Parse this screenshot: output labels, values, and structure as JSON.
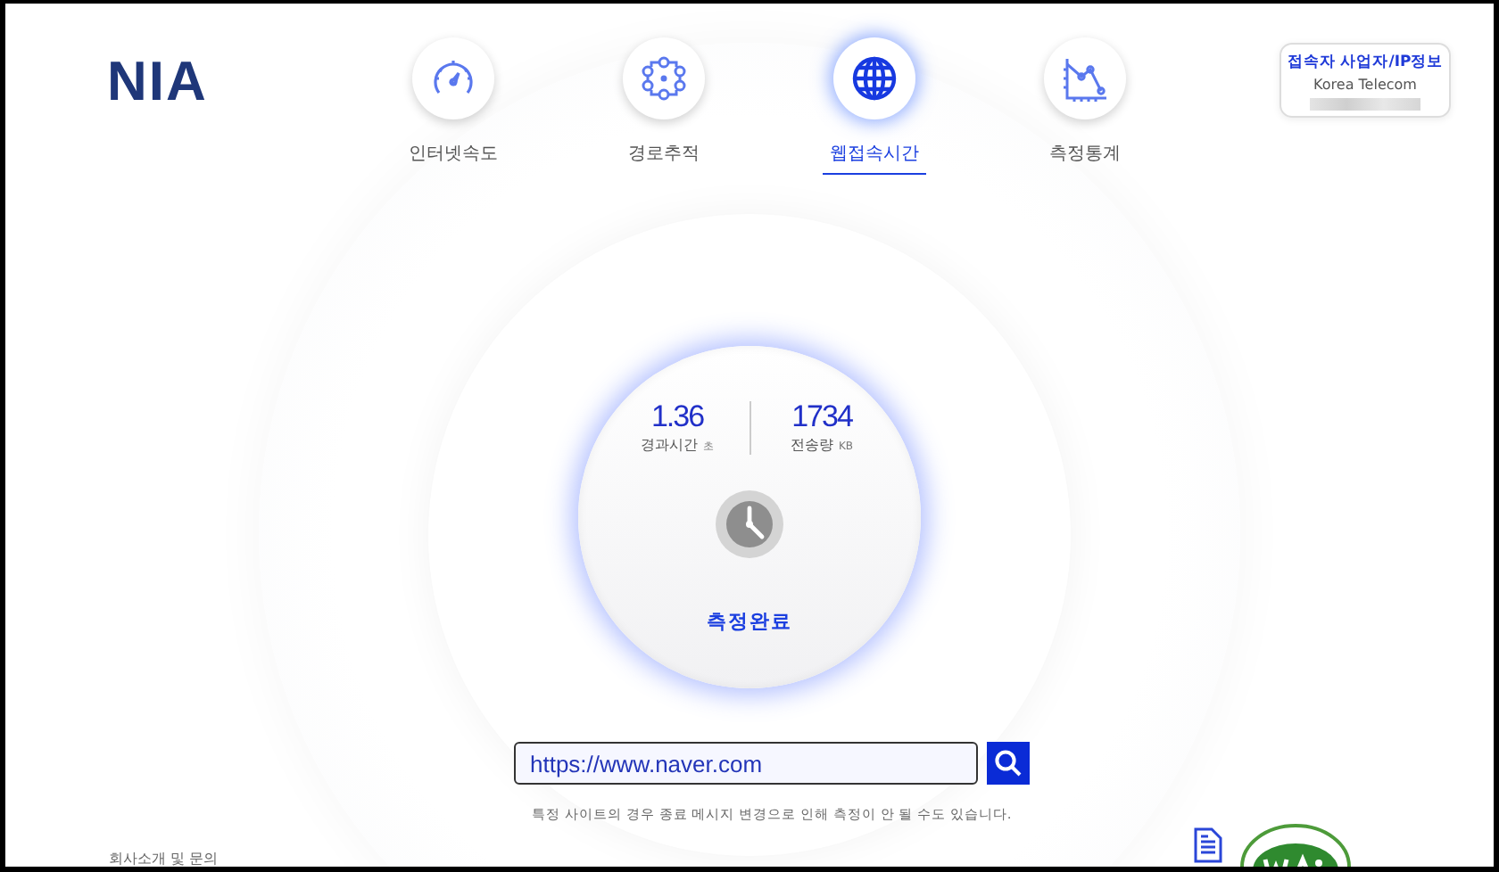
{
  "logo": "NIA",
  "nav": [
    {
      "label": "인터넷속도",
      "selected": false
    },
    {
      "label": "경로추적",
      "selected": false
    },
    {
      "label": "웹접속시간",
      "selected": true
    },
    {
      "label": "측정통계",
      "selected": false
    }
  ],
  "isp_info": {
    "title": "접속자 사업자/IP정보",
    "provider": "Korea Telecom"
  },
  "result": {
    "metrics": [
      {
        "value": "1.36",
        "label": "경과시간",
        "unit": "초"
      },
      {
        "value": "1734",
        "label": "전송량",
        "unit": "KB"
      }
    ],
    "status": "측정완료"
  },
  "url_input": {
    "value": "https://www.naver.com"
  },
  "notice": "특정 사이트의 경우 종료 메시지 변경으로 인해 측정이 안 될 수도 있습니다.",
  "footer": {
    "link": "회사소개 및 문의"
  }
}
